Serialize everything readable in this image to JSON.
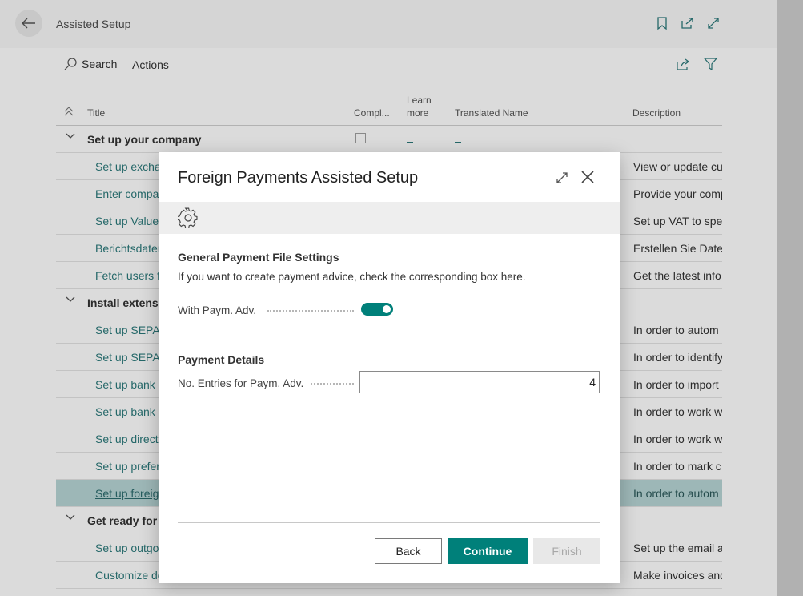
{
  "header": {
    "title": "Assisted Setup"
  },
  "actionbar": {
    "search_label": "Search",
    "actions_label": "Actions"
  },
  "columns": {
    "title": "Title",
    "completed": "Compl...",
    "learn_more_line1": "Learn",
    "learn_more_line2": "more",
    "translated_name": "Translated Name",
    "description": "Description"
  },
  "rows": [
    {
      "type": "group",
      "title": "Set up your company",
      "description": ""
    },
    {
      "type": "item",
      "title": "Set up excha",
      "description": "View or update cu"
    },
    {
      "type": "item",
      "title": "Enter compa",
      "description": "Provide your comp"
    },
    {
      "type": "item",
      "title": "Set up Value-",
      "description": "Set up VAT to spec"
    },
    {
      "type": "item",
      "title": "Berichtsdater",
      "description": "Erstellen Sie Dater"
    },
    {
      "type": "item",
      "title": "Fetch users f",
      "description": "Get the latest info"
    },
    {
      "type": "group",
      "title": "Install extensi",
      "description": ""
    },
    {
      "type": "item",
      "title": "Set up SEPA c",
      "description": "In order to autom"
    },
    {
      "type": "item",
      "title": "Set up SEPA c",
      "description": "In order to identify"
    },
    {
      "type": "item",
      "title": "Set up bank s",
      "description": "In order to import"
    },
    {
      "type": "item",
      "title": "Set up bank i",
      "description": "In order to work w"
    },
    {
      "type": "item",
      "title": "Set up direct",
      "description": "In order to work w"
    },
    {
      "type": "item",
      "title": "Set up prefer",
      "description": "In order to mark c"
    },
    {
      "type": "selected",
      "title": "Set up foreig",
      "description": "In order to autom"
    },
    {
      "type": "group",
      "title": "Get ready for",
      "description": ""
    },
    {
      "type": "item",
      "title": "Set up outgo",
      "description": "Set up the email a"
    },
    {
      "type": "item",
      "title": "Customize do",
      "description": "Make invoices and"
    }
  ],
  "dialog": {
    "title": "Foreign Payments Assisted Setup",
    "section1_title": "General Payment File Settings",
    "section1_text": "If you want to create payment advice, check the corresponding box here.",
    "with_paym_adv_label": "With Paym. Adv.",
    "with_paym_adv_on": true,
    "section2_title": "Payment Details",
    "entries_label": "No. Entries for Paym. Adv.",
    "entries_value": "4",
    "back_label": "Back",
    "continue_label": "Continue",
    "finish_label": "Finish"
  },
  "colors": {
    "accent": "#00807a",
    "link": "#2c7a7b",
    "selected_row": "#b7d6d6"
  }
}
